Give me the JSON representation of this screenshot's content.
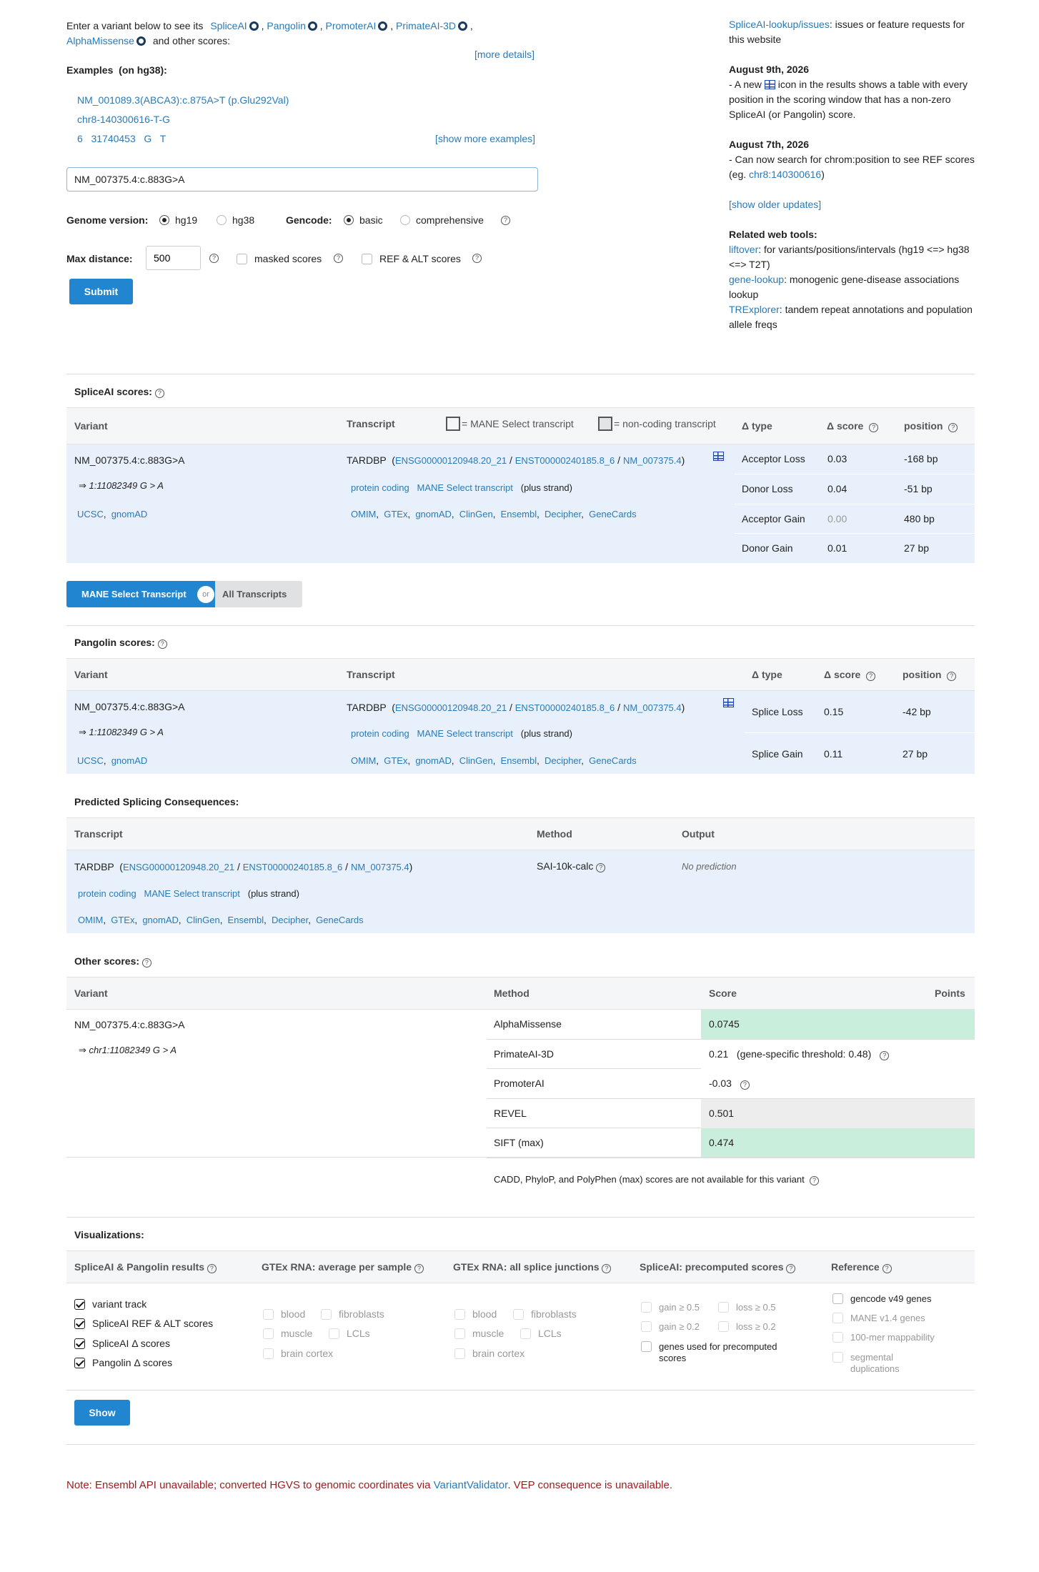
{
  "intro": {
    "text": "Enter a variant below to see its",
    "tools": [
      "SpliceAI",
      "Pangolin",
      "PromoterAI",
      "PrimateAI-3D",
      "AlphaMissense"
    ],
    "tail": "and other scores:",
    "more_details": "[more details]"
  },
  "examples": {
    "label": "Examples",
    "sub": "(on hg38):",
    "items": [
      "NM_001089.3(ABCA3):c.875A>T (p.Glu292Val)",
      "chr8-140300616-T-G",
      "6   31740453   G   T"
    ],
    "show_more": "[show more examples]"
  },
  "search": {
    "value": "NM_007375.4:c.883G>A"
  },
  "genome": {
    "label": "Genome version:",
    "options": [
      "hg19",
      "hg38"
    ],
    "selected": "hg19"
  },
  "gencode": {
    "label": "Gencode:",
    "options": [
      "basic",
      "comprehensive"
    ],
    "selected": "basic"
  },
  "maxdist": {
    "label": "Max distance:",
    "value": "500",
    "masked": "masked scores",
    "refalt": "REF & ALT scores"
  },
  "submit": "Submit",
  "sidebar": {
    "issues_link": "SpliceAI-lookup/issues",
    "issues_text": ": issues or feature requests for this website",
    "upd1_date": "August 9th, 2026",
    "upd1_a": "- A new",
    "upd1_b": "icon in the results shows a table with every position in the scoring window that has a non-zero SpliceAI (or Pangolin) score.",
    "upd2_date": "August 7th, 2026",
    "upd2_text": "- Can now search for chrom:position to see REF scores (eg.",
    "upd2_link": "chr8:140300616",
    "upd2_end": ")",
    "older": "[show older updates]",
    "tools_title": "Related web tools:",
    "tools": [
      {
        "name": "liftover",
        "desc": ": for variants/positions/intervals (hg19 <=> hg38 <=> T2T)"
      },
      {
        "name": "gene-lookup",
        "desc": ": monogenic gene-disease associations lookup"
      },
      {
        "name": "TRExplorer",
        "desc": ": tandem repeat annotations and population allele freqs"
      }
    ]
  },
  "variant": {
    "name": "NM_007375.4:c.883G>A",
    "coord": "⇒ 1:11082349 G > A",
    "coord2": "⇒ chr1:11082349 G > A",
    "links": [
      "UCSC",
      "gnomAD"
    ]
  },
  "transcript": {
    "gene": "TARDBP",
    "ensg": "ENSG00000120948.20_21",
    "enst": "ENST00000240185.8_6",
    "nm": "NM_007375.4",
    "biotype": "protein coding",
    "mane": "MANE Select transcript",
    "strand": "(plus strand)",
    "links": [
      "OMIM",
      "GTEx",
      "gnomAD",
      "ClinGen",
      "Ensembl",
      "Decipher",
      "GeneCards"
    ]
  },
  "spliceai": {
    "title": "SpliceAI scores:",
    "col_variant": "Variant",
    "col_transcript": "Transcript",
    "legend_mane": "= MANE Select transcript",
    "legend_nc": "= non-coding transcript",
    "col_type": "Δ type",
    "col_score": "Δ score",
    "col_pos": "position",
    "rows": [
      {
        "type": "Acceptor Loss",
        "score": "0.03",
        "pos": "-168 bp"
      },
      {
        "type": "Donor Loss",
        "score": "0.04",
        "pos": "-51 bp"
      },
      {
        "type": "Acceptor Gain",
        "score": "0.00",
        "pos": "480 bp"
      },
      {
        "type": "Donor Gain",
        "score": "0.01",
        "pos": "27 bp"
      }
    ]
  },
  "toggle": {
    "mane": "MANE Select Transcript",
    "or": "or",
    "all": "All Transcripts"
  },
  "pangolin": {
    "title": "Pangolin scores:",
    "rows": [
      {
        "type": "Splice Loss",
        "score": "0.15",
        "pos": "-42 bp"
      },
      {
        "type": "Splice Gain",
        "score": "0.11",
        "pos": "27 bp"
      }
    ]
  },
  "consequences": {
    "title": "Predicted Splicing Consequences:",
    "col_transcript": "Transcript",
    "col_method": "Method",
    "col_output": "Output",
    "method": "SAI-10k-calc",
    "output": "No prediction"
  },
  "other": {
    "title": "Other scores:",
    "col_variant": "Variant",
    "col_method": "Method",
    "col_score": "Score",
    "col_points": "Points",
    "rows": [
      {
        "method": "AlphaMissense",
        "score": "0.0745",
        "bg": "#c9eedc"
      },
      {
        "method": "PrimateAI-3D",
        "score": "0.21   (gene-specific threshold: 0.48)",
        "bg": "#ffffff"
      },
      {
        "method": "PromoterAI",
        "score": "-0.03",
        "bg": "#ffffff"
      },
      {
        "method": "REVEL",
        "score": "0.501",
        "bg": "#ededed"
      },
      {
        "method": "SIFT (max)",
        "score": "0.474",
        "bg": "#c9eedc"
      }
    ],
    "note": "CADD,  PhyloP,  and PolyPhen (max) scores are not available for this variant"
  },
  "viz": {
    "title": "Visualizations:",
    "cols": [
      "SpliceAI & Pangolin results",
      "GTEx RNA: average per sample",
      "GTEx RNA: all splice junctions",
      "SpliceAI: precomputed scores",
      "Reference"
    ],
    "c1": [
      "variant track",
      "SpliceAI REF & ALT scores",
      "SpliceAI Δ  scores",
      "Pangolin Δ  scores"
    ],
    "gtex": [
      "blood",
      "fibroblasts",
      "muscle",
      "LCLs",
      "brain cortex"
    ],
    "pre": [
      "gain ≥ 0.5",
      "loss ≥ 0.5",
      "gain ≥ 0.2",
      "loss ≥ 0.2",
      "genes used for precomputed scores"
    ],
    "ref": [
      "gencode v49 genes",
      "MANE v1.4 genes",
      "100-mer mappability",
      "segmental duplications"
    ],
    "show": "Show"
  },
  "note": {
    "a": "Note: Ensembl API unavailable; converted HGVS to genomic coordinates via",
    "link": "VariantValidator",
    "b": ". VEP consequence is unavailable."
  },
  "colors": {
    "link": "#2a7ab8",
    "button": "#2185d0",
    "table_body": "#e8f1fb",
    "note": "#9b1c1c"
  }
}
